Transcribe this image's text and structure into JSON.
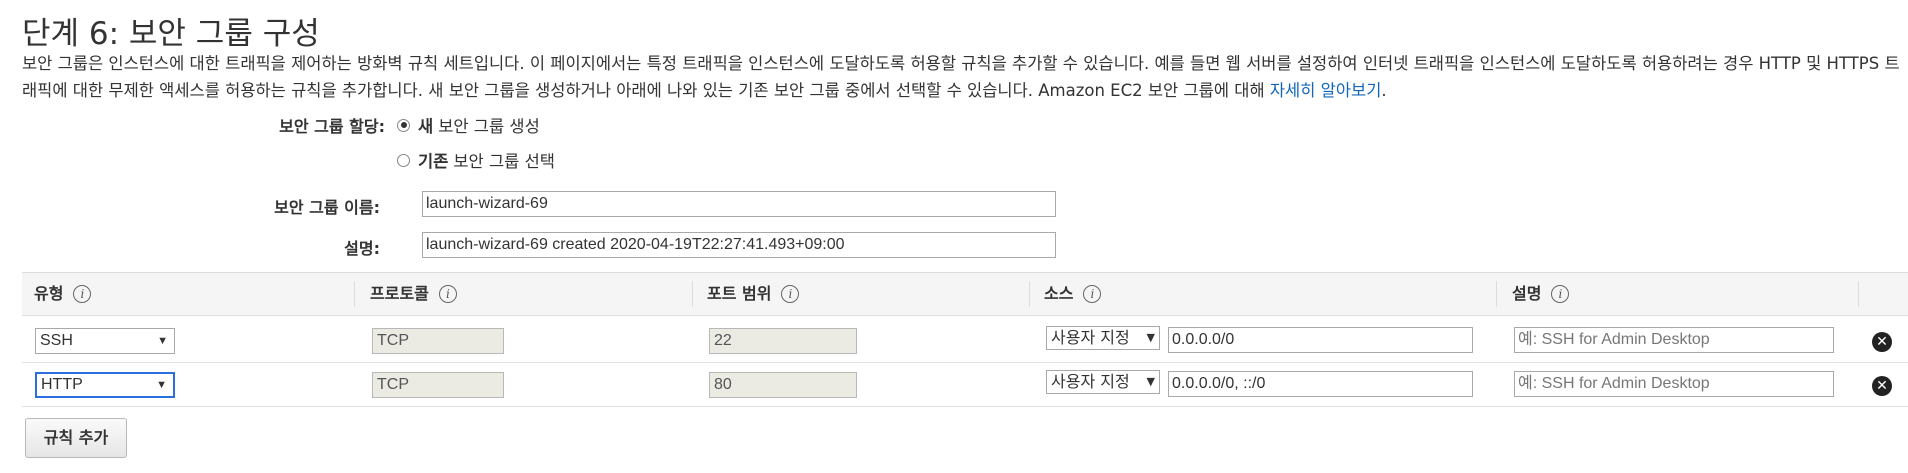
{
  "page": {
    "title": "단계 6: 보안 그룹 구성",
    "description": "보안 그룹은 인스턴스에 대한 트래픽을 제어하는 방화벽 규칙 세트입니다. 이 페이지에서는 특정 트래픽을 인스턴스에 도달하도록 허용할 규칙을 추가할 수 있습니다. 예를 들면 웹 서버를 설정하여 인터넷 트래픽을 인스턴스에 도달하도록 허용하려는 경우 HTTP 및 HTTPS 트래픽에 대한 무제한 액세스를 허용하는 규칙을 추가합니다. 새 보안 그룹을 생성하거나 아래에 나와 있는 기존 보안 그룹 중에서 선택할 수 있습니다. Amazon EC2 보안 그룹에 대해 ",
    "learn_more": "자세히 알아보기",
    "desc_end": "."
  },
  "form": {
    "assign_label": "보안 그룹 할당:",
    "option_new_bold": "새",
    "option_new_rest": "보안 그룹 생성",
    "option_existing_bold": "기존",
    "option_existing_rest": "보안 그룹 선택",
    "name_label": "보안 그룹 이름:",
    "name_value": "launch-wizard-69",
    "desc_label": "설명:",
    "desc_value": "launch-wizard-69 created 2020-04-19T22:27:41.493+09:00"
  },
  "table": {
    "headers": [
      "유형",
      "프로토콜",
      "포트 범위",
      "소스",
      "설명"
    ],
    "info_glyph": "i",
    "rows": [
      {
        "type": "SSH",
        "protocol": "TCP",
        "port": "22",
        "source_type": "사용자 지정",
        "source": "0.0.0.0/0",
        "desc_placeholder": "예: SSH for Admin Desktop"
      },
      {
        "type": "HTTP",
        "protocol": "TCP",
        "port": "80",
        "source_type": "사용자 지정",
        "source": "0.0.0.0/0, ::/0",
        "desc_placeholder": "예: SSH for Admin Desktop"
      }
    ],
    "arrow": "▼",
    "remove_glyph": "✕"
  },
  "actions": {
    "add_rule": "규칙 추가"
  }
}
